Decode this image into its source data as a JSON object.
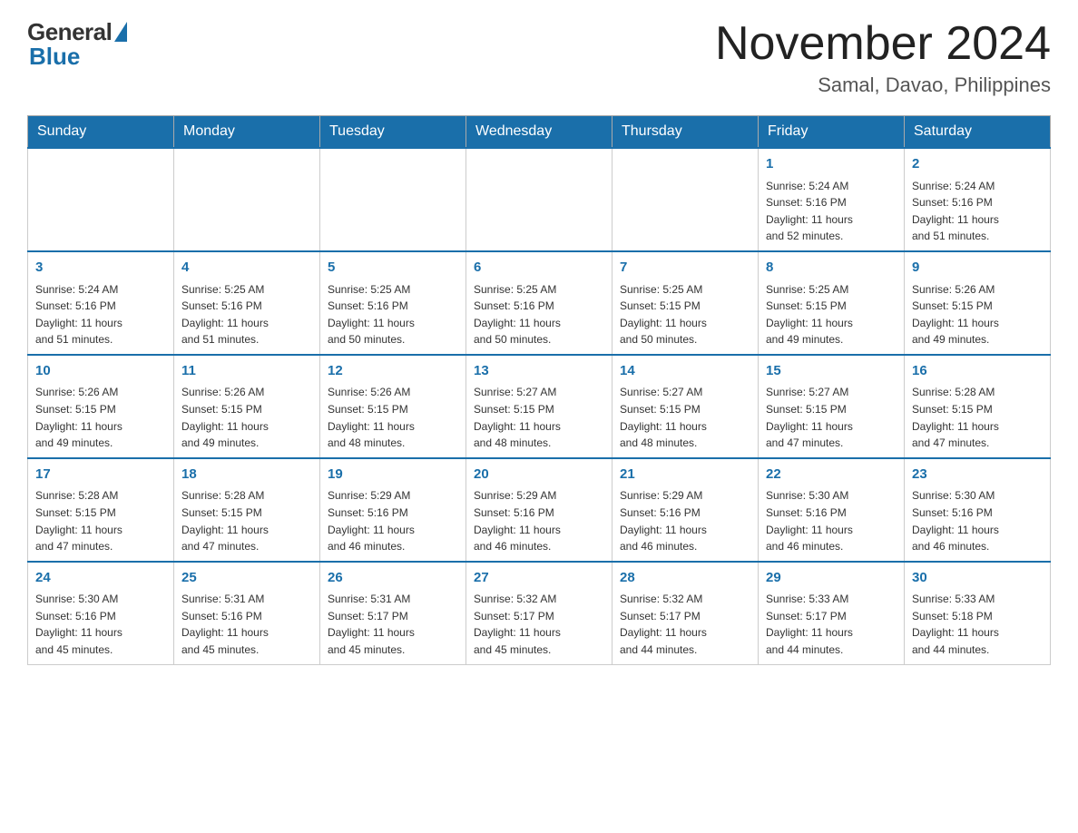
{
  "logo": {
    "general": "General",
    "blue": "Blue"
  },
  "title": "November 2024",
  "location": "Samal, Davao, Philippines",
  "days_of_week": [
    "Sunday",
    "Monday",
    "Tuesday",
    "Wednesday",
    "Thursday",
    "Friday",
    "Saturday"
  ],
  "weeks": [
    [
      {
        "day": "",
        "info": ""
      },
      {
        "day": "",
        "info": ""
      },
      {
        "day": "",
        "info": ""
      },
      {
        "day": "",
        "info": ""
      },
      {
        "day": "",
        "info": ""
      },
      {
        "day": "1",
        "info": "Sunrise: 5:24 AM\nSunset: 5:16 PM\nDaylight: 11 hours\nand 52 minutes."
      },
      {
        "day": "2",
        "info": "Sunrise: 5:24 AM\nSunset: 5:16 PM\nDaylight: 11 hours\nand 51 minutes."
      }
    ],
    [
      {
        "day": "3",
        "info": "Sunrise: 5:24 AM\nSunset: 5:16 PM\nDaylight: 11 hours\nand 51 minutes."
      },
      {
        "day": "4",
        "info": "Sunrise: 5:25 AM\nSunset: 5:16 PM\nDaylight: 11 hours\nand 51 minutes."
      },
      {
        "day": "5",
        "info": "Sunrise: 5:25 AM\nSunset: 5:16 PM\nDaylight: 11 hours\nand 50 minutes."
      },
      {
        "day": "6",
        "info": "Sunrise: 5:25 AM\nSunset: 5:16 PM\nDaylight: 11 hours\nand 50 minutes."
      },
      {
        "day": "7",
        "info": "Sunrise: 5:25 AM\nSunset: 5:15 PM\nDaylight: 11 hours\nand 50 minutes."
      },
      {
        "day": "8",
        "info": "Sunrise: 5:25 AM\nSunset: 5:15 PM\nDaylight: 11 hours\nand 49 minutes."
      },
      {
        "day": "9",
        "info": "Sunrise: 5:26 AM\nSunset: 5:15 PM\nDaylight: 11 hours\nand 49 minutes."
      }
    ],
    [
      {
        "day": "10",
        "info": "Sunrise: 5:26 AM\nSunset: 5:15 PM\nDaylight: 11 hours\nand 49 minutes."
      },
      {
        "day": "11",
        "info": "Sunrise: 5:26 AM\nSunset: 5:15 PM\nDaylight: 11 hours\nand 49 minutes."
      },
      {
        "day": "12",
        "info": "Sunrise: 5:26 AM\nSunset: 5:15 PM\nDaylight: 11 hours\nand 48 minutes."
      },
      {
        "day": "13",
        "info": "Sunrise: 5:27 AM\nSunset: 5:15 PM\nDaylight: 11 hours\nand 48 minutes."
      },
      {
        "day": "14",
        "info": "Sunrise: 5:27 AM\nSunset: 5:15 PM\nDaylight: 11 hours\nand 48 minutes."
      },
      {
        "day": "15",
        "info": "Sunrise: 5:27 AM\nSunset: 5:15 PM\nDaylight: 11 hours\nand 47 minutes."
      },
      {
        "day": "16",
        "info": "Sunrise: 5:28 AM\nSunset: 5:15 PM\nDaylight: 11 hours\nand 47 minutes."
      }
    ],
    [
      {
        "day": "17",
        "info": "Sunrise: 5:28 AM\nSunset: 5:15 PM\nDaylight: 11 hours\nand 47 minutes."
      },
      {
        "day": "18",
        "info": "Sunrise: 5:28 AM\nSunset: 5:15 PM\nDaylight: 11 hours\nand 47 minutes."
      },
      {
        "day": "19",
        "info": "Sunrise: 5:29 AM\nSunset: 5:16 PM\nDaylight: 11 hours\nand 46 minutes."
      },
      {
        "day": "20",
        "info": "Sunrise: 5:29 AM\nSunset: 5:16 PM\nDaylight: 11 hours\nand 46 minutes."
      },
      {
        "day": "21",
        "info": "Sunrise: 5:29 AM\nSunset: 5:16 PM\nDaylight: 11 hours\nand 46 minutes."
      },
      {
        "day": "22",
        "info": "Sunrise: 5:30 AM\nSunset: 5:16 PM\nDaylight: 11 hours\nand 46 minutes."
      },
      {
        "day": "23",
        "info": "Sunrise: 5:30 AM\nSunset: 5:16 PM\nDaylight: 11 hours\nand 46 minutes."
      }
    ],
    [
      {
        "day": "24",
        "info": "Sunrise: 5:30 AM\nSunset: 5:16 PM\nDaylight: 11 hours\nand 45 minutes."
      },
      {
        "day": "25",
        "info": "Sunrise: 5:31 AM\nSunset: 5:16 PM\nDaylight: 11 hours\nand 45 minutes."
      },
      {
        "day": "26",
        "info": "Sunrise: 5:31 AM\nSunset: 5:17 PM\nDaylight: 11 hours\nand 45 minutes."
      },
      {
        "day": "27",
        "info": "Sunrise: 5:32 AM\nSunset: 5:17 PM\nDaylight: 11 hours\nand 45 minutes."
      },
      {
        "day": "28",
        "info": "Sunrise: 5:32 AM\nSunset: 5:17 PM\nDaylight: 11 hours\nand 44 minutes."
      },
      {
        "day": "29",
        "info": "Sunrise: 5:33 AM\nSunset: 5:17 PM\nDaylight: 11 hours\nand 44 minutes."
      },
      {
        "day": "30",
        "info": "Sunrise: 5:33 AM\nSunset: 5:18 PM\nDaylight: 11 hours\nand 44 minutes."
      }
    ]
  ]
}
